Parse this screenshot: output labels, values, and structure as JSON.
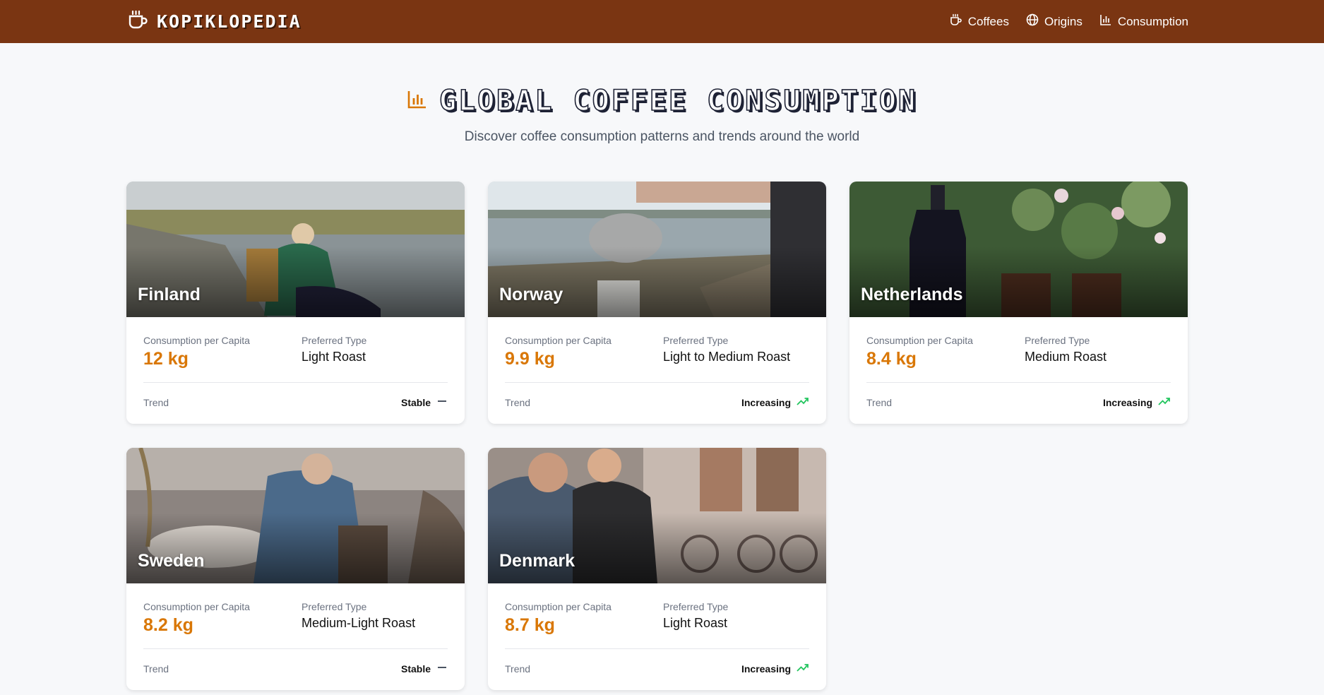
{
  "header": {
    "brand": "KOPIKLOPEDIA",
    "nav": [
      {
        "label": "Coffees",
        "icon": "coffee-cup-icon"
      },
      {
        "label": "Origins",
        "icon": "globe-icon"
      },
      {
        "label": "Consumption",
        "icon": "bar-chart-icon"
      }
    ]
  },
  "hero": {
    "title": "GLOBAL COFFEE CONSUMPTION",
    "subtitle": "Discover coffee consumption patterns and trends around the world"
  },
  "labels": {
    "consumption": "Consumption per Capita",
    "preferred": "Preferred Type",
    "trend": "Trend"
  },
  "cards": [
    {
      "country": "Finland",
      "consumption": "12 kg",
      "preferred": "Light Roast",
      "trend": "Stable",
      "trend_icon": "dash-icon"
    },
    {
      "country": "Norway",
      "consumption": "9.9 kg",
      "preferred": "Light to Medium Roast",
      "trend": "Increasing",
      "trend_icon": "trending-up-icon"
    },
    {
      "country": "Netherlands",
      "consumption": "8.4 kg",
      "preferred": "Medium Roast",
      "trend": "Increasing",
      "trend_icon": "trending-up-icon"
    },
    {
      "country": "Sweden",
      "consumption": "8.2 kg",
      "preferred": "Medium-Light Roast",
      "trend": "Stable",
      "trend_icon": "dash-icon"
    },
    {
      "country": "Denmark",
      "consumption": "8.7 kg",
      "preferred": "Light Roast",
      "trend": "Increasing",
      "trend_icon": "trending-up-icon"
    }
  ],
  "colors": {
    "header": "#7a3512",
    "accent": "#d97706",
    "trend_up": "#22c55e"
  }
}
